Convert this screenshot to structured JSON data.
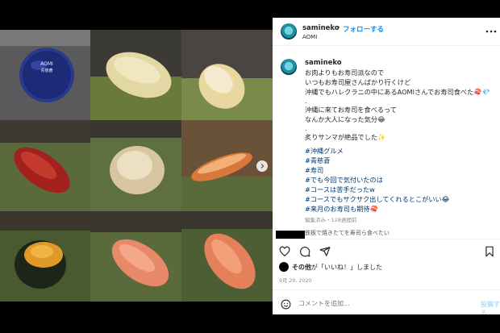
{
  "post": {
    "username": "samineko",
    "follow_label": "フォローする",
    "separator": "•",
    "location": "AOMI",
    "caption_username": "samineko",
    "caption_lines": [
      "お肉よりもお寿司派なので",
      "いつもお寿司屋さんばかり行くけど",
      "沖縄でもハレクラニの中にあるAOMIさんでお寿司食べた🍣💎",
      ".",
      "沖縄に来てお寿司を食べるって",
      "なんか大人になった気分😂",
      ".",
      "炙りサンマが絶品でした✨"
    ],
    "hashtags": [
      "#沖縄グルメ",
      "#青慈蒼",
      "#寿司",
      "#でも今回で気付いたのは",
      "#コースは苦手だったw",
      "#コースでもサクサク出してくれるとこがいい😂",
      "#来月のお寿司も期待🍣"
    ],
    "edited_text": "編集済み・128週間前",
    "cutoff_comment": "鉄板で焼きたてを寿司ら食べたい",
    "likes_text_bold": "その他",
    "likes_text_rest": "が「いいね！」しました",
    "date": "9月 29, 2020",
    "comment_placeholder": "コメントを追加...",
    "post_button": "投稿する"
  },
  "grid": {
    "badge_text_lines": [
      "AOMI",
      "青慈蒼"
    ]
  },
  "icons": {
    "more": "more-icon",
    "like": "heart-icon",
    "comment": "comment-icon",
    "share": "share-icon",
    "save": "bookmark-icon",
    "emoji": "emoji-icon",
    "carousel_next": "chevron-right-icon"
  },
  "colors": {
    "follow_blue": "#0095f6",
    "hashtag_blue": "#00376b",
    "muted_gray": "#8e8e8e"
  }
}
